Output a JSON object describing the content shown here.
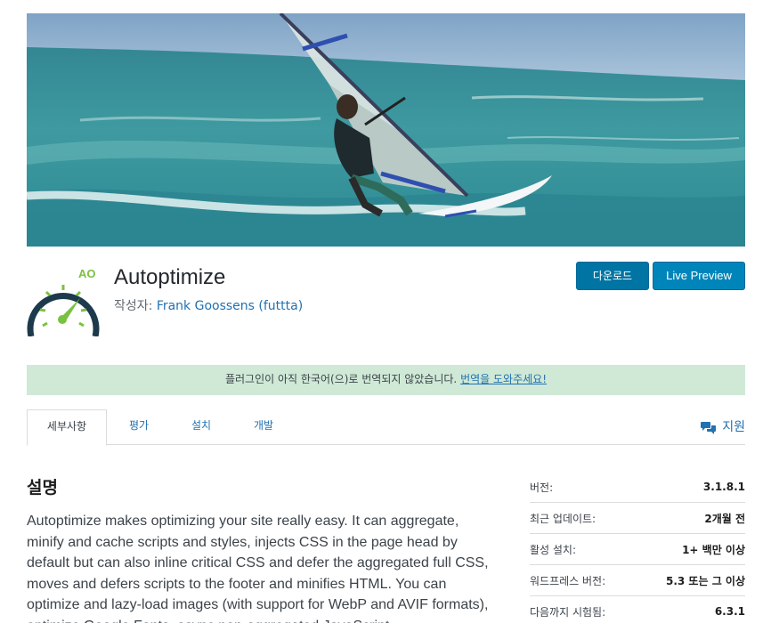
{
  "banner": {
    "alt": "windsurfer banner"
  },
  "plugin": {
    "icon_text": "AO",
    "title": "Autoptimize",
    "author_prefix": "작성자: ",
    "author_name": "Frank Goossens (futtta)"
  },
  "actions": {
    "download_label": "다운로드",
    "preview_label": "Live Preview"
  },
  "notice": {
    "text": "플러그인이 아직 한국어(으)로 번역되지 않았습니다. ",
    "link": "번역을 도와주세요!"
  },
  "tabs": {
    "details": "세부사항",
    "reviews": "평가",
    "install": "설치",
    "development": "개발",
    "support": "지원"
  },
  "main": {
    "section_title": "설명",
    "description": "Autoptimize makes optimizing your site really easy. It can aggregate, minify and cache scripts and styles, injects CSS in the page head by default but can also inline critical CSS and defer the aggregated full CSS, moves and defers scripts to the footer and minifies HTML. You can optimize and lazy-load images (with support for WebP and AVIF formats), optimize Google Fonts, async non-aggregated JavaScript,"
  },
  "meta": [
    {
      "label": "버전:",
      "value": "3.1.8.1"
    },
    {
      "label": "최근 업데이트:",
      "value": "2개월 전"
    },
    {
      "label": "활성 설치:",
      "value": "1+ 백만 이상"
    },
    {
      "label": "워드프레스 버전:",
      "value": "5.3 또는 그 이상"
    },
    {
      "label": "다음까지 시험됨:",
      "value": "6.3.1"
    }
  ],
  "colors": {
    "accent": "#0074a2",
    "link": "#2271b1",
    "notice_bg": "#cfe9d6",
    "icon_green": "#7ac142",
    "icon_navy": "#1d3a4d"
  },
  "icons": {
    "support": "speech-bubbles-icon",
    "gauge": "speedometer-icon"
  }
}
